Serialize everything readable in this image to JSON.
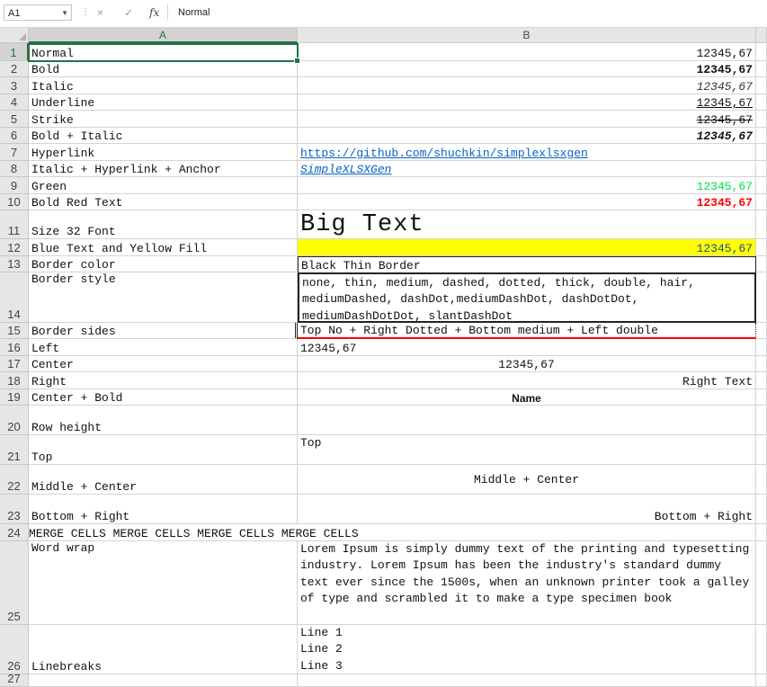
{
  "formula_bar": {
    "name_box": "A1",
    "formula": "Normal",
    "fx_label": "fx",
    "cancel_icon": "×",
    "enter_icon": "✓"
  },
  "columns": [
    "A",
    "B"
  ],
  "rows": [
    {
      "num": "1",
      "a": "Normal",
      "b": "12345,67"
    },
    {
      "num": "2",
      "a": "Bold",
      "b": "12345,67"
    },
    {
      "num": "3",
      "a": "Italic",
      "b": "12345,67"
    },
    {
      "num": "4",
      "a": "Underline",
      "b": "12345,67"
    },
    {
      "num": "5",
      "a": "Strike",
      "b": "12345,67"
    },
    {
      "num": "6",
      "a": "Bold + Italic",
      "b": "12345,67"
    },
    {
      "num": "7",
      "a": "Hyperlink",
      "b": "https://github.com/shuchkin/simplexlsxgen"
    },
    {
      "num": "8",
      "a": "Italic + Hyperlink + Anchor",
      "b": "SimpleXLSXGen"
    },
    {
      "num": "9",
      "a": "Green",
      "b": "12345,67"
    },
    {
      "num": "10",
      "a": "Bold Red Text",
      "b": "12345,67"
    },
    {
      "num": "11",
      "a": "Size 32 Font",
      "b": "Big Text"
    },
    {
      "num": "12",
      "a": "Blue Text and Yellow Fill",
      "b": "12345,67"
    },
    {
      "num": "13",
      "a": "Border color",
      "b": "Black Thin Border"
    },
    {
      "num": "14",
      "a": "Border style",
      "b": "none, thin, medium, dashed, dotted, thick, double, hair, mediumDashed, dashDot,mediumDashDot, dashDotDot, mediumDashDotDot, slantDashDot"
    },
    {
      "num": "15",
      "a": "Border sides",
      "b": "Top No + Right Dotted + Bottom medium + Left double"
    },
    {
      "num": "16",
      "a": "Left",
      "b": "12345,67"
    },
    {
      "num": "17",
      "a": "Center",
      "b": "12345,67"
    },
    {
      "num": "18",
      "a": "Right",
      "b": "Right Text"
    },
    {
      "num": "19",
      "a": "Center + Bold",
      "b": "Name"
    },
    {
      "num": "20",
      "a": "Row height",
      "b": ""
    },
    {
      "num": "21",
      "a": "Top",
      "b": "Top"
    },
    {
      "num": "22",
      "a": "Middle + Center",
      "b": "Middle + Center"
    },
    {
      "num": "23",
      "a": "Bottom + Right",
      "b": "Bottom + Right"
    },
    {
      "num": "24",
      "a": "MERGE CELLS MERGE CELLS MERGE CELLS MERGE CELLS",
      "b": ""
    },
    {
      "num": "25",
      "a": "Word wrap",
      "b": "Lorem Ipsum is simply dummy text of the printing and typesetting industry. Lorem Ipsum has been the industry's standard dummy text ever since the 1500s, when an unknown printer took a galley of type and scrambled it to make a type specimen book"
    },
    {
      "num": "26",
      "a": "Linebreaks",
      "b_lines": [
        "Line 1",
        "Line 2",
        "Line 3"
      ]
    },
    {
      "num": "27",
      "a": "",
      "b": ""
    }
  ],
  "colors": {
    "green": "#00e04b",
    "red": "#ff0000",
    "yellow_fill": "#ffff00",
    "link": "#0563c1",
    "selection": "#217346",
    "border_sides_bottom": "#ff0000"
  }
}
